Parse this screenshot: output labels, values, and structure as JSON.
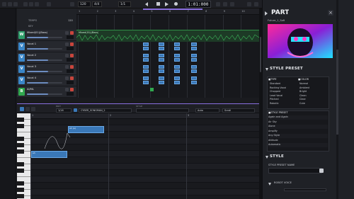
{
  "transport": {
    "time": "1:01:000",
    "tempo_value": "120",
    "sig": "4/4",
    "pos_field": "1/1"
  },
  "global": {
    "tempo_label": "TEMPO",
    "tempo_val": "120",
    "key_label": "KEY",
    "key_val": "C"
  },
  "tracks": [
    {
      "badge": "W",
      "name": "Mixed(01)(Bass)",
      "color": "#2f9e6b"
    },
    {
      "badge": "V",
      "name": "Vocal 1",
      "color": "#3a86c8"
    },
    {
      "badge": "V",
      "name": "Vocal 2",
      "color": "#3a86c8"
    },
    {
      "badge": "V",
      "name": "Vocal 3",
      "color": "#3a86c8"
    },
    {
      "badge": "V",
      "name": "Vocal 4",
      "color": "#3a86c8"
    },
    {
      "badge": "B",
      "name": "AI/ML",
      "color": "#31a84f"
    }
  ],
  "timeline": {
    "markers": [
      "1",
      "2",
      "3",
      "4",
      "5",
      "6",
      "7",
      "8",
      "9",
      "10"
    ],
    "wave_label": "Mixed(01)(Bass)"
  },
  "piano_roll": {
    "toolbar": {
      "tool_label": "EDIT",
      "quant_val": "1/16",
      "singer_val": "CYBER_SONGMAN_2",
      "style_label": "STYLE",
      "tempo_field": "Auto",
      "scroll_label": "Scroll"
    },
    "ruler": [
      "1",
      "2",
      "3",
      "4"
    ],
    "notes": [
      {
        "lbl": "ah"
      },
      {
        "lbl": "ah (a)"
      }
    ]
  },
  "right": {
    "part_title": "PART",
    "part_name": "Future_1_Soft",
    "style_preset_title": "STYLE PRESET",
    "type_header": "■TYPE",
    "color_header": "■COLOR",
    "type_items": [
      "Standard",
      "Rocking Vocal",
      "Chopped",
      "Lead Vocal",
      "Pitched",
      "Robotic"
    ],
    "color_items": [
      "Normal",
      "Ambient",
      "Bright",
      "Clean",
      "Clear",
      "Cute"
    ],
    "style_preset_header": "■STYLE PRESET",
    "presets": [
      "Again and Again",
      "Air Sky",
      "Alone",
      "Amplify",
      "Any Style",
      "Attitude",
      "Automatic"
    ],
    "style_title": "STYLE",
    "style_preset_name_label": "STYLE PRESET NAME",
    "robot_voice_label": "ROBOT VOICE"
  },
  "colors": {
    "accent": "#8a6fe0",
    "track_green": "#2f9e6b",
    "track_blue": "#3a86c8",
    "note_blue": "#3a78b8",
    "waveform": "#2f8f45"
  }
}
